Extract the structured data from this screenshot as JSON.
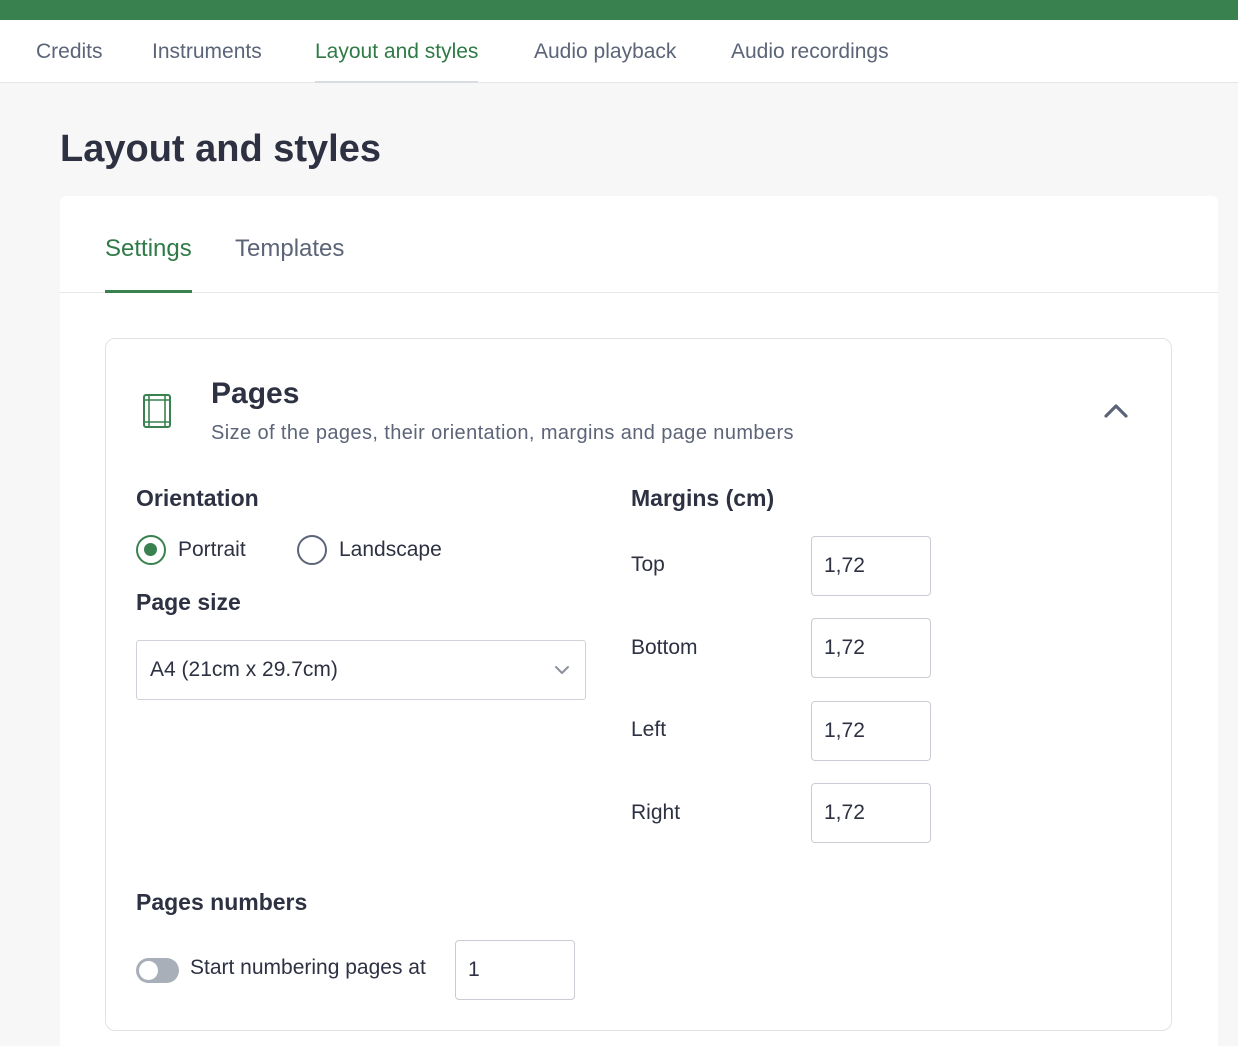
{
  "top_nav": {
    "tabs": [
      {
        "label": "Credits"
      },
      {
        "label": "Instruments"
      },
      {
        "label": "Layout and styles",
        "active": true
      },
      {
        "label": "Audio playback"
      },
      {
        "label": "Audio recordings"
      }
    ]
  },
  "page": {
    "title": "Layout and styles"
  },
  "sub_tabs": [
    {
      "label": "Settings",
      "active": true
    },
    {
      "label": "Templates"
    }
  ],
  "pages_section": {
    "icon": "page-frame-icon",
    "title": "Pages",
    "subtitle": "Size of the pages, their orientation, margins and page numbers",
    "collapse_icon": "chevron-up-icon",
    "orientation": {
      "label": "Orientation",
      "options": [
        "Portrait",
        "Landscape"
      ],
      "selected": "Portrait"
    },
    "page_size": {
      "label": "Page size",
      "value": "A4 (21cm x 29.7cm)"
    },
    "margins": {
      "label": "Margins (cm)",
      "top_label": "Top",
      "top_value": "1,72",
      "bottom_label": "Bottom",
      "bottom_value": "1,72",
      "left_label": "Left",
      "left_value": "1,72",
      "right_label": "Right",
      "right_value": "1,72"
    },
    "page_numbers": {
      "label": "Pages numbers",
      "toggle_on": false,
      "toggle_label": "Start numbering pages at",
      "start_value": "1"
    }
  },
  "colors": {
    "accent": "#3a8150",
    "text": "#2d3142",
    "muted": "#5c6478"
  }
}
